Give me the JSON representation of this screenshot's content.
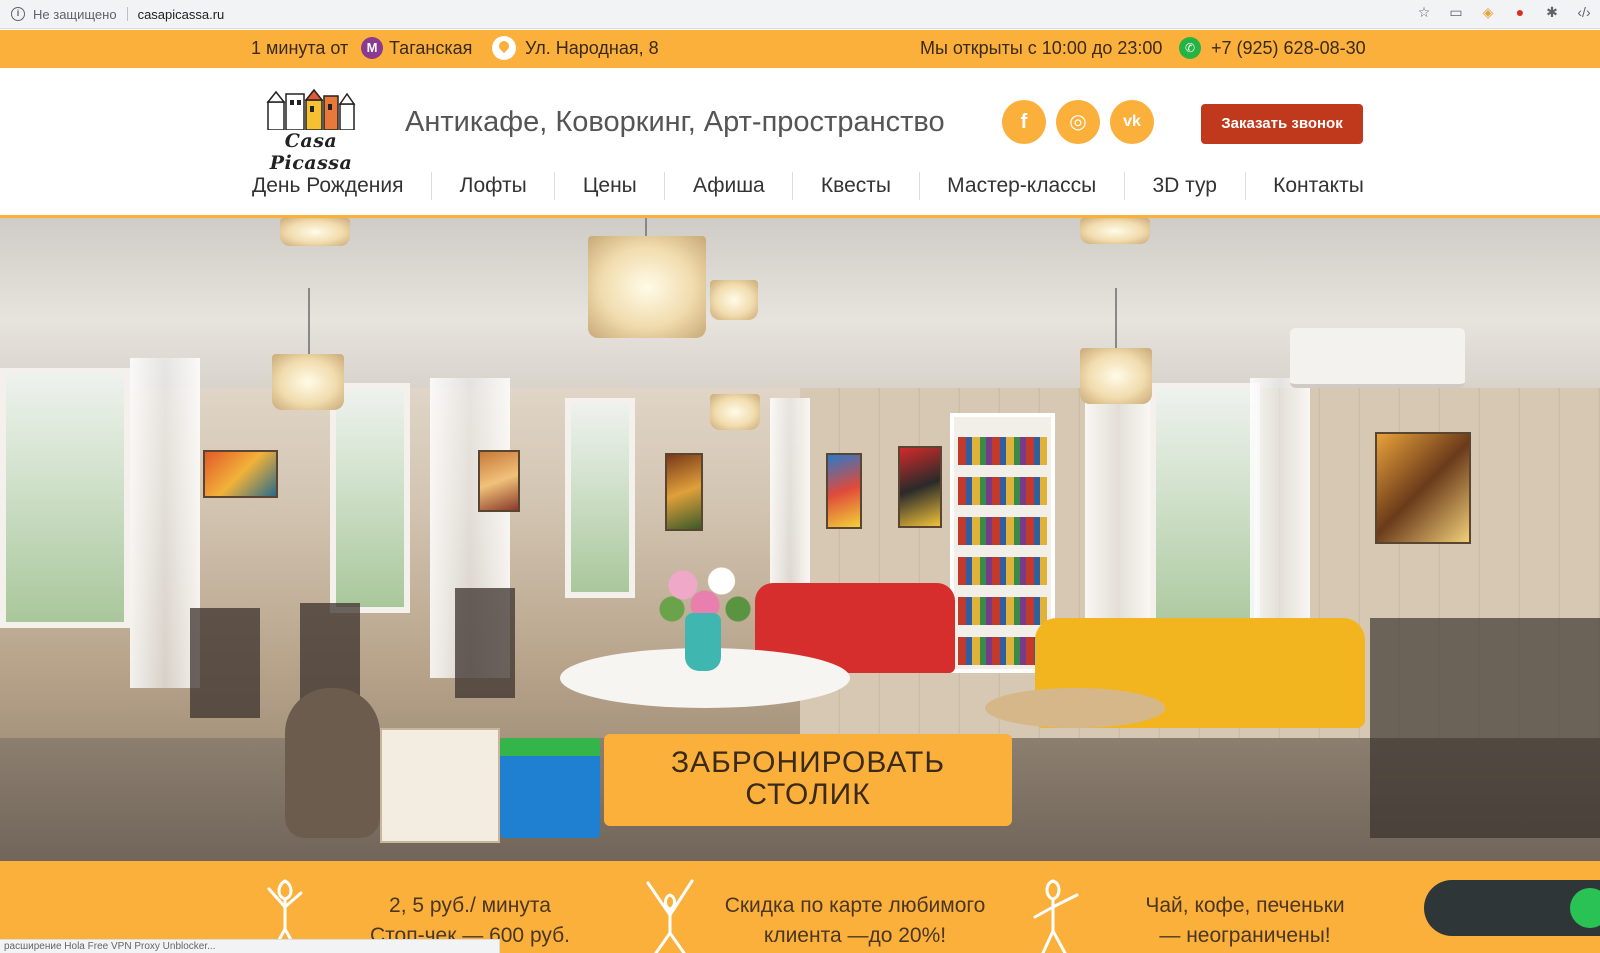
{
  "browser": {
    "security_label": "Не защищено",
    "url": "casapicassa.ru",
    "icons": [
      "info-icon",
      "star-icon",
      "cast-icon",
      "extension-icon",
      "opera-icon",
      "bug-icon",
      "devtools-icon"
    ]
  },
  "topbar": {
    "distance": "1 минута от",
    "metro_letter": "М",
    "station": "Таганская",
    "address": "Ул. Народная, 8",
    "hours": "Мы открыты с 10:00 до 23:00",
    "phone": "+7 (925) 628-08-30",
    "background": "#fbb03b"
  },
  "header": {
    "logo_text": "Casa Picassa",
    "tagline": "Антикафе, Коворкинг, Арт-пространство",
    "social": {
      "facebook": "f",
      "instagram": "◎",
      "vk": "vk"
    },
    "callback_label": "Заказать звонок",
    "callback_color": "#c0391c"
  },
  "nav": {
    "items": [
      "День Рождения",
      "Лофты",
      "Цены",
      "Афиша",
      "Квесты",
      "Мастер-классы",
      "3D тур",
      "Контакты"
    ]
  },
  "hero": {
    "book_line1": "ЗАБРОНИРОВАТЬ",
    "book_line2": "СТОЛИК"
  },
  "promo": {
    "item1_line1": "2, 5 руб./ минута",
    "item1_line2": "Стоп-чек — 600 руб.",
    "item2_line1": "Скидка по карте любимого",
    "item2_line2": "клиента —до  20%!",
    "item3_line1": "Чай, кофе, печеньки",
    "item3_line2": "— неограничены!"
  },
  "status_bar": "расширение Hola Free VPN Proxy Unblocker..."
}
